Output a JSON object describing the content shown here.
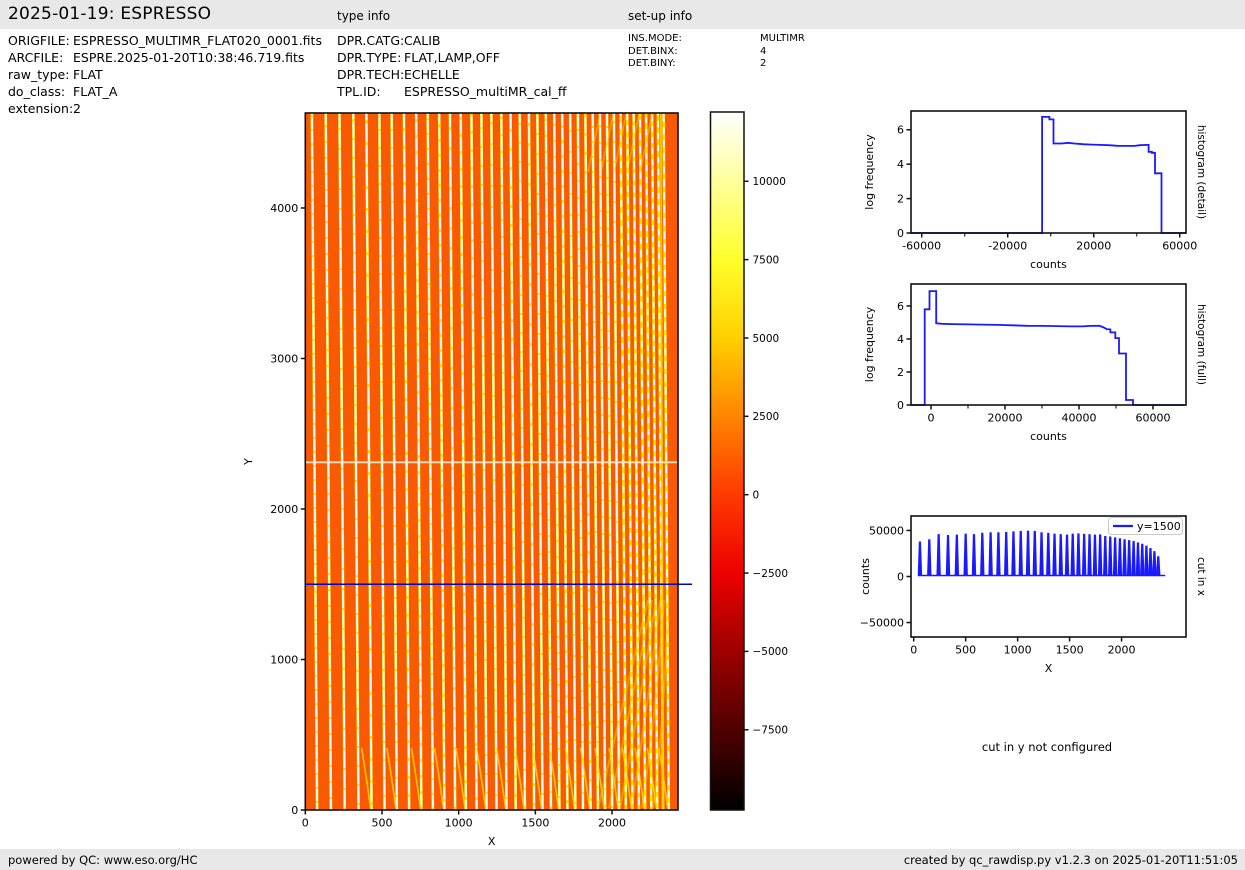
{
  "header": {
    "title": "2025-01-19: ESPRESSO",
    "type_info_label": "type info",
    "setup_info_label": "set-up info"
  },
  "file_info": {
    "rows": [
      {
        "label": "ORIGFILE:",
        "value": "ESPRESSO_MULTIMR_FLAT020_0001.fits"
      },
      {
        "label": "ARCFILE:",
        "value": "ESPRE.2025-01-20T10:38:46.719.fits"
      },
      {
        "label": "raw_type:",
        "value": "FLAT"
      },
      {
        "label": "do_class:",
        "value": "FLAT_A"
      },
      {
        "label": "extension:",
        "value": "2"
      }
    ]
  },
  "type_info": {
    "rows": [
      {
        "label": "DPR.CATG:",
        "value": "CALIB"
      },
      {
        "label": "DPR.TYPE:",
        "value": "FLAT,LAMP,OFF"
      },
      {
        "label": "DPR.TECH:",
        "value": "ECHELLE"
      },
      {
        "label": "TPL.ID:",
        "value": "ESPRESSO_multiMR_cal_ff"
      }
    ]
  },
  "setup_info": {
    "rows": [
      {
        "label": "INS.MODE:",
        "value": "MULTIMR"
      },
      {
        "label": "DET.BINX:",
        "value": "4"
      },
      {
        "label": "DET.BINY:",
        "value": "2"
      }
    ]
  },
  "footer": {
    "left": "powered by QC: www.eso.org/HC",
    "right": "created by qc_rawdisp.py v1.2.3 on 2025-01-20T11:51:05"
  },
  "colors": {
    "band_bg": "#e8e8e8",
    "curve_blue": "#1a1aff",
    "image_bg": "#f95a00",
    "stripe_white": "#ffffff",
    "stripe_yellow": "#ffdf00",
    "gap_line": "#ffe3c8",
    "cutline_blue": "#0000c8",
    "spine": "#111111",
    "legend_border": "#c9c9c9"
  },
  "chart_data": [
    {
      "id": "raw_image",
      "type": "heatmap",
      "xlabel": "X",
      "ylabel": "Y",
      "xlim": [
        0,
        2430
      ],
      "ylim": [
        0,
        4631
      ],
      "xticks": [
        [
          0,
          "0"
        ],
        [
          500,
          "500"
        ],
        [
          1000,
          "1000"
        ],
        [
          1500,
          "1500"
        ],
        [
          2000,
          "2000"
        ]
      ],
      "yticks": [
        [
          0,
          "0"
        ],
        [
          1000,
          "1000"
        ],
        [
          2000,
          "2000"
        ],
        [
          3000,
          "3000"
        ],
        [
          4000,
          "4000"
        ]
      ],
      "colormap": "hot",
      "background_value": 1000,
      "detector_gap_y": 2310,
      "cut_line_y": 1500,
      "orders_x": [
        60,
        150,
        240,
        330,
        415,
        500,
        580,
        660,
        740,
        815,
        890,
        960,
        1030,
        1100,
        1165,
        1230,
        1295,
        1355,
        1415,
        1475,
        1530,
        1585,
        1640,
        1692,
        1744,
        1794,
        1843,
        1891,
        1938,
        1984,
        2029,
        2073,
        2116,
        2158,
        2199,
        2239,
        2278,
        2316,
        2353
      ],
      "features": [
        "~39 near-vertical bright echelle-order stripes, crowding toward high X",
        "white detector gap line near y=2310",
        "blue horizontal cut line at y=1500",
        "yellow curved order tails near bottom and right edge"
      ],
      "colorbar": {
        "vmin": -10060,
        "vmax": 12210,
        "ticks": [
          [
            10000,
            "10000"
          ],
          [
            7500,
            "7500"
          ],
          [
            5000,
            "5000"
          ],
          [
            2500,
            "2500"
          ],
          [
            0,
            "0"
          ],
          [
            -2500,
            "−2500"
          ],
          [
            -5000,
            "−5000"
          ],
          [
            -7500,
            "−7500"
          ]
        ],
        "gradient_stops": [
          [
            0,
            "#000000"
          ],
          [
            0.115,
            "#500000"
          ],
          [
            0.227,
            "#9e0000"
          ],
          [
            0.339,
            "#ed0000"
          ],
          [
            0.452,
            "#ff3a00"
          ],
          [
            0.564,
            "#ff8500"
          ],
          [
            0.676,
            "#ffd000"
          ],
          [
            0.789,
            "#ffff2b"
          ],
          [
            0.901,
            "#ffff9c"
          ],
          [
            1,
            "#ffffff"
          ]
        ]
      }
    },
    {
      "id": "histogram_detail",
      "type": "line",
      "right_title": "histogram (detail)",
      "xlabel": "counts",
      "ylabel": "log frequency",
      "xlim": [
        -64976,
        62900
      ],
      "ylim": [
        0,
        7.09
      ],
      "xticks": [
        [
          -60000,
          "-60000"
        ],
        [
          -20000,
          "-20000"
        ],
        [
          20000,
          "20000"
        ],
        [
          60000,
          "60000"
        ]
      ],
      "xticks_minor": [
        -40000,
        0,
        40000
      ],
      "yticks": [
        [
          0,
          "0"
        ],
        [
          2,
          "2"
        ],
        [
          4,
          "4"
        ],
        [
          6,
          "6"
        ]
      ],
      "points": [
        [
          -64976,
          0
        ],
        [
          -4000,
          0
        ],
        [
          -4000,
          6.75
        ],
        [
          -600,
          6.75
        ],
        [
          -600,
          6.6
        ],
        [
          1300,
          6.6
        ],
        [
          1300,
          5.2
        ],
        [
          5000,
          5.2
        ],
        [
          8000,
          5.24
        ],
        [
          11000,
          5.2
        ],
        [
          15000,
          5.16
        ],
        [
          19000,
          5.14
        ],
        [
          23000,
          5.12
        ],
        [
          27000,
          5.1
        ],
        [
          31000,
          5.07
        ],
        [
          35000,
          5.06
        ],
        [
          39000,
          5.06
        ],
        [
          41500,
          5.1
        ],
        [
          44500,
          5.12
        ],
        [
          45500,
          5.12
        ],
        [
          45500,
          4.72
        ],
        [
          47000,
          4.72
        ],
        [
          47000,
          4.66
        ],
        [
          48500,
          4.66
        ],
        [
          48500,
          3.47
        ],
        [
          51500,
          3.47
        ],
        [
          51500,
          0
        ],
        [
          62900,
          0
        ]
      ]
    },
    {
      "id": "histogram_full",
      "type": "line",
      "right_title": "histogram (full)",
      "xlabel": "counts",
      "ylabel": "log frequency",
      "xlim": [
        -5405,
        68919
      ],
      "ylim": [
        0,
        7.33
      ],
      "xticks": [
        [
          0,
          "0"
        ],
        [
          20000,
          "20000"
        ],
        [
          40000,
          "40000"
        ],
        [
          60000,
          "60000"
        ]
      ],
      "xticks_minor": [
        10000,
        30000,
        50000
      ],
      "yticks": [
        [
          0,
          "0"
        ],
        [
          2,
          "2"
        ],
        [
          4,
          "4"
        ],
        [
          6,
          "6"
        ]
      ],
      "points": [
        [
          -5405,
          0
        ],
        [
          -1700,
          0
        ],
        [
          -1700,
          5.8
        ],
        [
          -400,
          5.8
        ],
        [
          -400,
          6.9
        ],
        [
          1400,
          6.9
        ],
        [
          1400,
          4.95
        ],
        [
          3000,
          4.92
        ],
        [
          6000,
          4.9
        ],
        [
          10000,
          4.88
        ],
        [
          14000,
          4.87
        ],
        [
          18000,
          4.85
        ],
        [
          22000,
          4.83
        ],
        [
          26000,
          4.8
        ],
        [
          30000,
          4.79
        ],
        [
          34000,
          4.78
        ],
        [
          38000,
          4.76
        ],
        [
          41000,
          4.76
        ],
        [
          43000,
          4.79
        ],
        [
          45500,
          4.8
        ],
        [
          46500,
          4.72
        ],
        [
          47500,
          4.6
        ],
        [
          48500,
          4.58
        ],
        [
          48500,
          4.4
        ],
        [
          49800,
          4.4
        ],
        [
          49800,
          4.05
        ],
        [
          50800,
          4.05
        ],
        [
          50800,
          3.12
        ],
        [
          52700,
          3.12
        ],
        [
          52700,
          0.3
        ],
        [
          54600,
          0.3
        ],
        [
          54600,
          0
        ],
        [
          68500,
          0
        ]
      ]
    },
    {
      "id": "cut_in_x",
      "type": "line",
      "right_title": "cut in x",
      "xlabel": "X",
      "ylabel": "counts",
      "legend_label": "y=1500",
      "xlim": [
        -26,
        2620
      ],
      "ylim": [
        -65700,
        65700
      ],
      "xticks": [
        [
          0,
          "0"
        ],
        [
          500,
          "500"
        ],
        [
          1000,
          "1000"
        ],
        [
          1500,
          "1500"
        ],
        [
          2000,
          "2000"
        ]
      ],
      "yticks": [
        [
          -50000,
          "−50000"
        ],
        [
          0,
          "0"
        ],
        [
          50000,
          "50000"
        ]
      ],
      "baseline": 1100,
      "peaks_x": [
        60,
        150,
        240,
        330,
        415,
        500,
        580,
        660,
        740,
        815,
        890,
        960,
        1030,
        1100,
        1165,
        1230,
        1295,
        1355,
        1415,
        1475,
        1530,
        1585,
        1640,
        1692,
        1744,
        1794,
        1843,
        1891,
        1938,
        1984,
        2029,
        2073,
        2116,
        2158,
        2199,
        2239,
        2278,
        2316,
        2353
      ],
      "peaks_h": [
        38000,
        40500,
        46000,
        45000,
        45500,
        46500,
        46000,
        47500,
        48000,
        48000,
        48500,
        49000,
        49500,
        49800,
        49500,
        48000,
        47500,
        46500,
        46000,
        45500,
        46500,
        46800,
        46300,
        46000,
        45500,
        45800,
        44000,
        43500,
        42500,
        41500,
        40500,
        39500,
        38500,
        37000,
        35500,
        33500,
        31000,
        27500,
        22000
      ]
    },
    {
      "id": "cut_in_y_note",
      "type": "text",
      "text": "cut in y not configured"
    }
  ]
}
